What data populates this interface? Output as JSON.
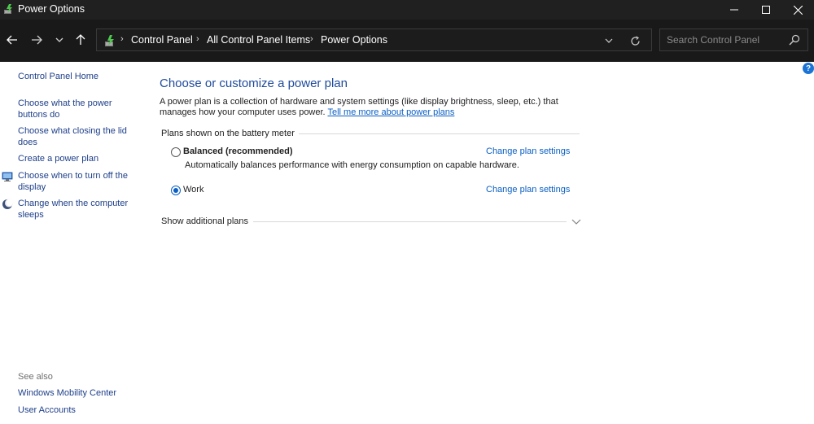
{
  "window": {
    "title": "Power Options",
    "icon": "power-options-icon"
  },
  "navigation": {
    "breadcrumbs": [
      "Control Panel",
      "All Control Panel Items",
      "Power Options"
    ],
    "search_placeholder": "Search Control Panel"
  },
  "sidebar": {
    "home_label": "Control Panel Home",
    "items": [
      {
        "label": "Choose what the power buttons do",
        "icon": ""
      },
      {
        "label": "Choose what closing the lid does",
        "icon": ""
      },
      {
        "label": "Create a power plan",
        "icon": ""
      },
      {
        "label": "Choose when to turn off the display",
        "icon": "display-icon"
      },
      {
        "label": "Change when the computer sleeps",
        "icon": "sleep-icon"
      }
    ],
    "see_also_label": "See also",
    "see_also": [
      "Windows Mobility Center",
      "User Accounts"
    ]
  },
  "main": {
    "title": "Choose or customize a power plan",
    "intro_text": "A power plan is a collection of hardware and system settings (like display brightness, sleep, etc.) that manages how your computer uses power.",
    "intro_link": "Tell me more about power plans",
    "group_label": "Plans shown on the battery meter",
    "plans": [
      {
        "name": "Balanced (recommended)",
        "selected": false,
        "description": "Automatically balances performance with energy consumption on capable hardware.",
        "link": "Change plan settings"
      },
      {
        "name": "Work",
        "selected": true,
        "description": "",
        "link": "Change plan settings"
      }
    ],
    "show_more_label": "Show additional plans"
  },
  "help": {
    "label": "?"
  },
  "colors": {
    "accent": "#0a5fc4",
    "title_blue": "#1e4a9c",
    "titlebar_bg": "#202020",
    "navbar_bg": "#191919"
  }
}
